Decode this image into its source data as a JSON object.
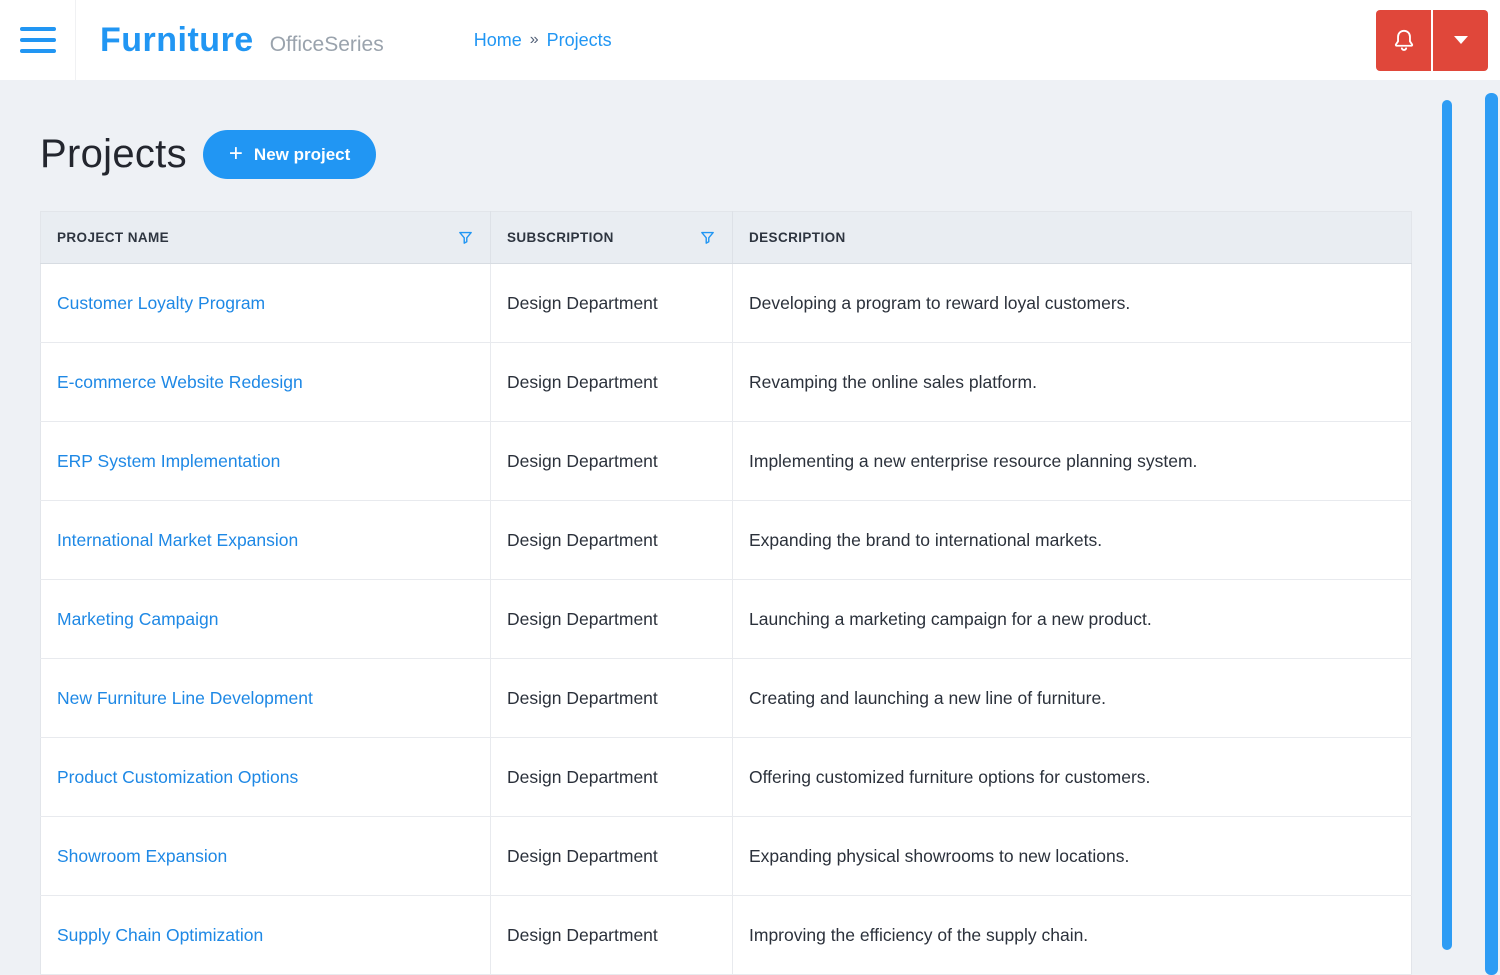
{
  "header": {
    "brand": "Furniture",
    "brand_sub": "OfficeSeries",
    "breadcrumb": {
      "home": "Home",
      "separator": "»",
      "current": "Projects"
    }
  },
  "page": {
    "title": "Projects",
    "new_project_label": "New project",
    "plus_glyph": "+"
  },
  "table": {
    "columns": [
      {
        "label": "PROJECT NAME",
        "filter": true
      },
      {
        "label": "SUBSCRIPTION",
        "filter": true
      },
      {
        "label": "DESCRIPTION",
        "filter": false
      }
    ],
    "rows": [
      {
        "name": "Customer Loyalty Program",
        "subscription": "Design Department",
        "description": "Developing a program to reward loyal customers."
      },
      {
        "name": "E-commerce Website Redesign",
        "subscription": "Design Department",
        "description": "Revamping the online sales platform."
      },
      {
        "name": "ERP System Implementation",
        "subscription": "Design Department",
        "description": "Implementing a new enterprise resource planning system."
      },
      {
        "name": "International Market Expansion",
        "subscription": "Design Department",
        "description": "Expanding the brand to international markets."
      },
      {
        "name": "Marketing Campaign",
        "subscription": "Design Department",
        "description": "Launching a marketing campaign for a new product."
      },
      {
        "name": "New Furniture Line Development",
        "subscription": "Design Department",
        "description": "Creating and launching a new line of furniture."
      },
      {
        "name": "Product Customization Options",
        "subscription": "Design Department",
        "description": "Offering customized furniture options for customers."
      },
      {
        "name": "Showroom Expansion",
        "subscription": "Design Department",
        "description": "Expanding physical showrooms to new locations."
      },
      {
        "name": "Supply Chain Optimization",
        "subscription": "Design Department",
        "description": "Improving the efficiency of the supply chain."
      }
    ]
  },
  "icons": {
    "menu": "hamburger-menu",
    "bell": "notification-bell",
    "caret": "dropdown-caret",
    "filter": "filter-funnel"
  },
  "colors": {
    "accent_blue": "#2196f3",
    "link_blue": "#1e88e5",
    "alert_red": "#e0473a",
    "page_bg": "#eef1f5",
    "table_header_bg": "#e9edf2"
  }
}
